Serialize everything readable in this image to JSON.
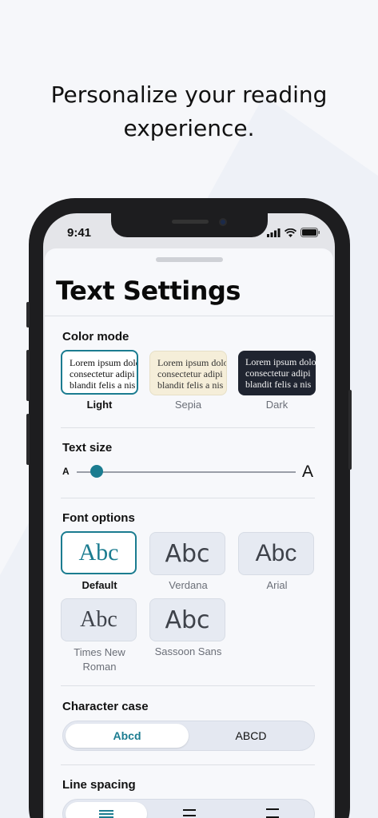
{
  "headline": [
    "Personalize your reading",
    "experience."
  ],
  "status_bar": {
    "time": "9:41"
  },
  "sheet": {
    "title": "Text Settings",
    "color_mode": {
      "label": "Color mode",
      "preview_lines": [
        "Lorem ipsum dolor",
        "consectetur adipi",
        "blandit felis a nis"
      ],
      "options": [
        "Light",
        "Sepia",
        "Dark"
      ],
      "selected": "Light"
    },
    "text_size": {
      "label": "Text size",
      "small_glyph": "A",
      "large_glyph": "A",
      "value_fraction": 0.09
    },
    "font_options": {
      "label": "Font options",
      "sample": "Abc",
      "fonts": [
        "Default",
        "Verdana",
        "Arial",
        "Times New Roman",
        "Sassoon Sans"
      ],
      "font_captions": [
        "Default",
        "Verdana",
        "Arial",
        "Times New",
        "Roman",
        "Sassoon Sans"
      ],
      "selected": "Default"
    },
    "character_case": {
      "label": "Character case",
      "options": [
        "Abcd",
        "ABCD"
      ],
      "selected": "Abcd"
    },
    "line_spacing": {
      "label": "Line spacing"
    }
  },
  "colors": {
    "accent": "#1b7c90",
    "sepia_bg": "#f5eed9",
    "dark_bg": "#1f2430",
    "background": "#f6f7fa"
  },
  "icons": [
    "signal-icon",
    "wifi-icon",
    "battery-icon",
    "line-spacing-compact-icon",
    "line-spacing-normal-icon",
    "line-spacing-wide-icon"
  ]
}
